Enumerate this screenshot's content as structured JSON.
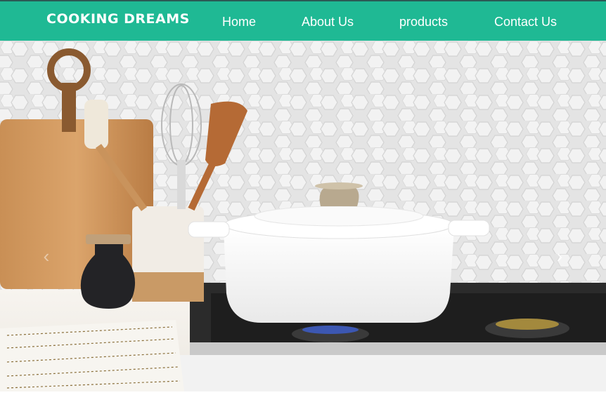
{
  "brand": {
    "name": "COOKING DREAMS"
  },
  "nav": {
    "items": [
      {
        "label": "Home"
      },
      {
        "label": "About Us"
      },
      {
        "label": "products"
      },
      {
        "label": "Contact Us"
      }
    ]
  },
  "carousel": {
    "prev_icon": "chevron-left-icon",
    "next_icon": "chevron-right-icon",
    "prev_glyph": "‹",
    "next_glyph": "›",
    "slide_count": 1,
    "active_slide": 1
  },
  "colors": {
    "navbar": "#1fb994",
    "navbar_border": "#2b5a55",
    "nav_text": "#ffffff"
  }
}
